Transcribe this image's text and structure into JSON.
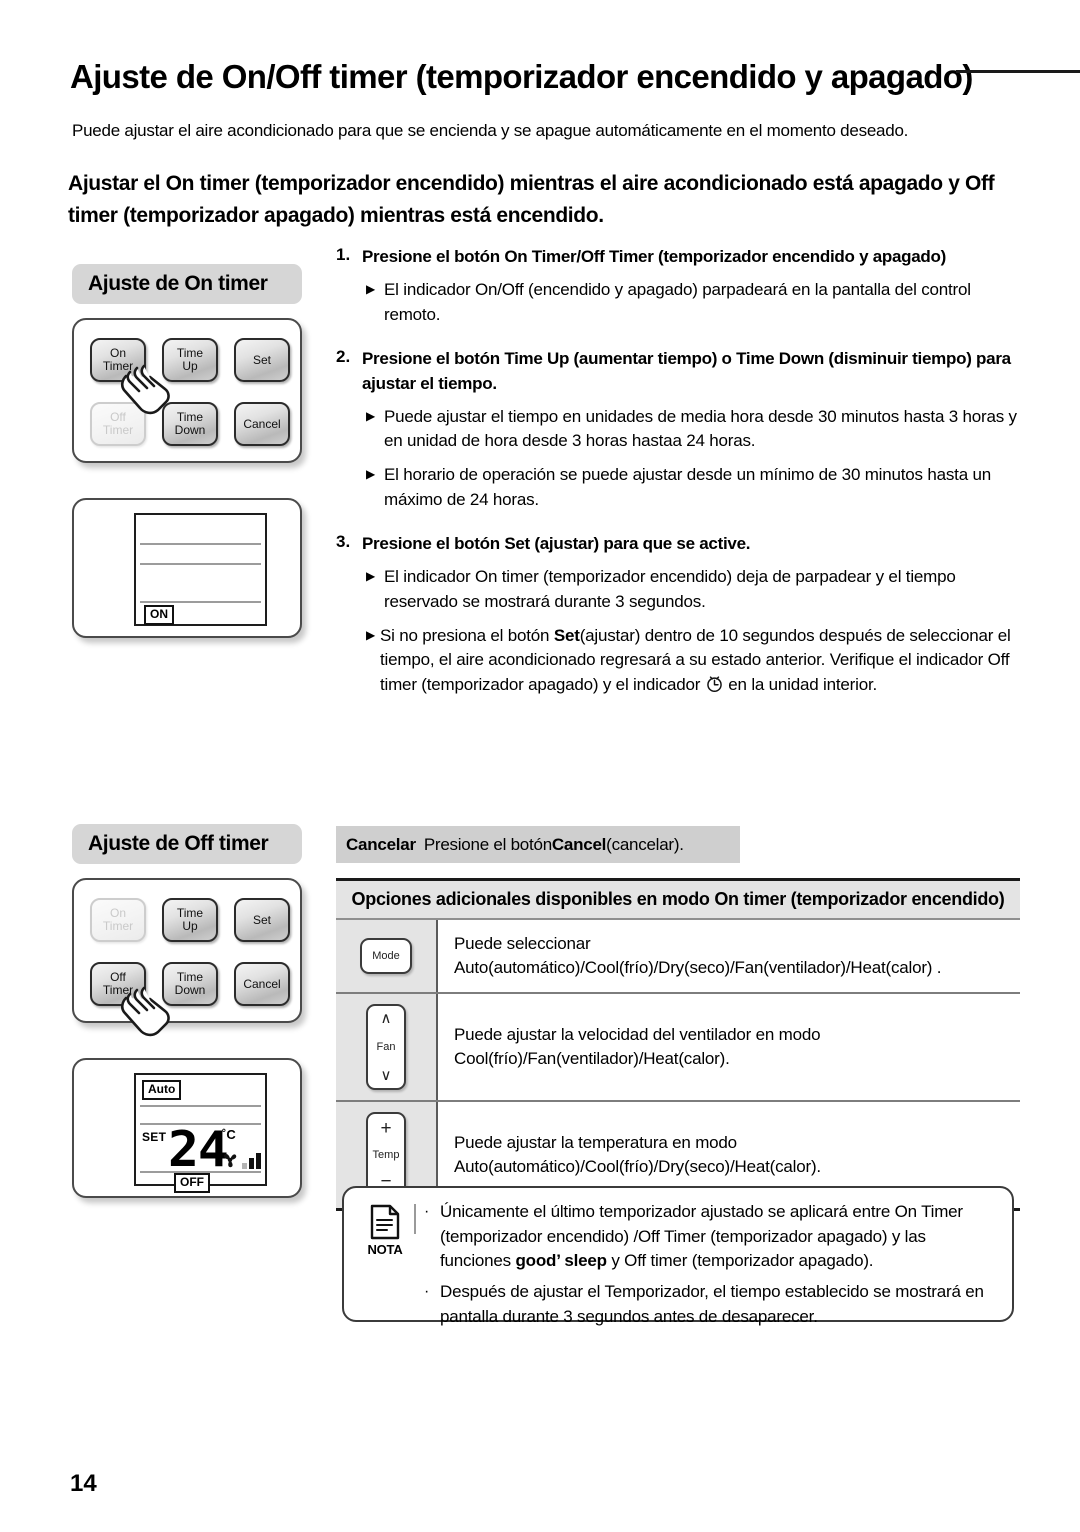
{
  "header": {
    "title": "Ajuste de On/Off timer (temporizador encendido y apagado)",
    "intro": "Puede ajustar el aire acondicionado para que se encienda y se apague automáticamente en el momento deseado.",
    "section_heading": "Ajustar el On timer (temporizador encendido) mientras el aire acondicionado está apagado y Off timer (temporizador apagado) mientras está encendido."
  },
  "figures": {
    "on_timer": {
      "caption": "Ajuste de On timer",
      "buttons": [
        {
          "label1": "On",
          "label2": "Timer",
          "state": "active",
          "pressed": true
        },
        {
          "label1": "Time",
          "label2": "Up",
          "state": "active",
          "pressed": false
        },
        {
          "label1": "Set",
          "label2": "",
          "state": "active",
          "pressed": false
        },
        {
          "label1": "Off",
          "label2": "Timer",
          "state": "dimmed",
          "pressed": false
        },
        {
          "label1": "Time",
          "label2": "Down",
          "state": "active",
          "pressed": false
        },
        {
          "label1": "Cancel",
          "label2": "",
          "state": "active",
          "pressed": false
        }
      ],
      "display": {
        "bottom_tag": "ON"
      }
    },
    "off_timer": {
      "caption": "Ajuste de Off timer",
      "buttons": [
        {
          "label1": "On",
          "label2": "Timer",
          "state": "dimmed",
          "pressed": false
        },
        {
          "label1": "Time",
          "label2": "Up",
          "state": "active",
          "pressed": false
        },
        {
          "label1": "Set",
          "label2": "",
          "state": "active",
          "pressed": false
        },
        {
          "label1": "Off",
          "label2": "Timer",
          "state": "active",
          "pressed": true
        },
        {
          "label1": "Time",
          "label2": "Down",
          "state": "active",
          "pressed": false
        },
        {
          "label1": "Cancel",
          "label2": "",
          "state": "active",
          "pressed": false
        }
      ],
      "display": {
        "mode_tag": "Auto",
        "set_label": "SET",
        "temperature": "24",
        "unit": "˚C",
        "bottom_tag": "OFF",
        "fan_bars": 3
      }
    }
  },
  "steps": [
    {
      "number": "1.",
      "text": "Presione el botón On Timer/Off Timer (temporizador encendido y apagado)",
      "bullets": [
        "El indicador On/Off (encendido y apagado) parpadeará en la pantalla del control remoto."
      ]
    },
    {
      "number": "2.",
      "text": "Presione el botón Time Up (aumentar tiempo) o Time Down (disminuir tiempo) para ajustar el tiempo.",
      "bullets": [
        "Puede ajustar el tiempo en unidades de media hora desde 30 minutos hasta 3 horas y en unidad de hora desde 3 horas hastaa 24 horas.",
        "El horario de operación se puede ajustar desde un mínimo de 30 minutos hasta un máximo de 24 horas."
      ]
    },
    {
      "number": "3.",
      "text": "Presione el botón Set (ajustar) para que se active.",
      "bullets": [
        "El indicador On timer (temporizador encendido) deja de parpadear y el tiempo reservado se mostrará durante 3 segundos."
      ]
    }
  ],
  "step3_long_bullet": {
    "part1": "Si no presiona el botón ",
    "bold": "Set",
    "part2": "(ajustar) dentro de 10 segundos después de seleccionar el tiempo, el aire acondicionado regresará a su estado anterior. Verifique el indicador Off timer (temporizador apagado) y el indicador ",
    "part3": " en la unidad interior."
  },
  "cancel_strip": {
    "lead": "Cancelar",
    "text_before": "Presione el botón ",
    "bold": "Cancel",
    "text_after": " (cancelar)."
  },
  "options_table": {
    "header": "Opciones adicionales disponibles en modo On timer (temporizador encendido)",
    "rows": [
      {
        "icon_name": "mode-key",
        "key_label": "Mode",
        "description": "Puede seleccionar Auto(automático)/Cool(frío)/Dry(seco)/Fan(ventilador)/Heat(calor) ."
      },
      {
        "icon_name": "fan-key",
        "key_label": "Fan",
        "description": "Puede ajustar la velocidad del ventilador en modo Cool(frío)/Fan(ventilador)/Heat(calor)."
      },
      {
        "icon_name": "temp-key",
        "key_label": "Temp",
        "description": "Puede ajustar la temperatura en modo Auto(automático)/Cool(frío)/Dry(seco)/Heat(calor)."
      }
    ]
  },
  "nota": {
    "label": "NOTA",
    "item1": {
      "part1": "Únicamente el último temporizador ajustado se aplicará entre On Timer (temporizador encendido) /Off Timer (temporizador apagado) y las funciones ",
      "bold": "good’ sleep",
      "part2": " y Off timer (temporizador apagado)."
    },
    "item2": "Después de ajustar el Temporizador, el tiempo establecido se mostrará en pantalla durante 3 segundos antes de desaparecer."
  },
  "footer": {
    "page_number": "14"
  }
}
